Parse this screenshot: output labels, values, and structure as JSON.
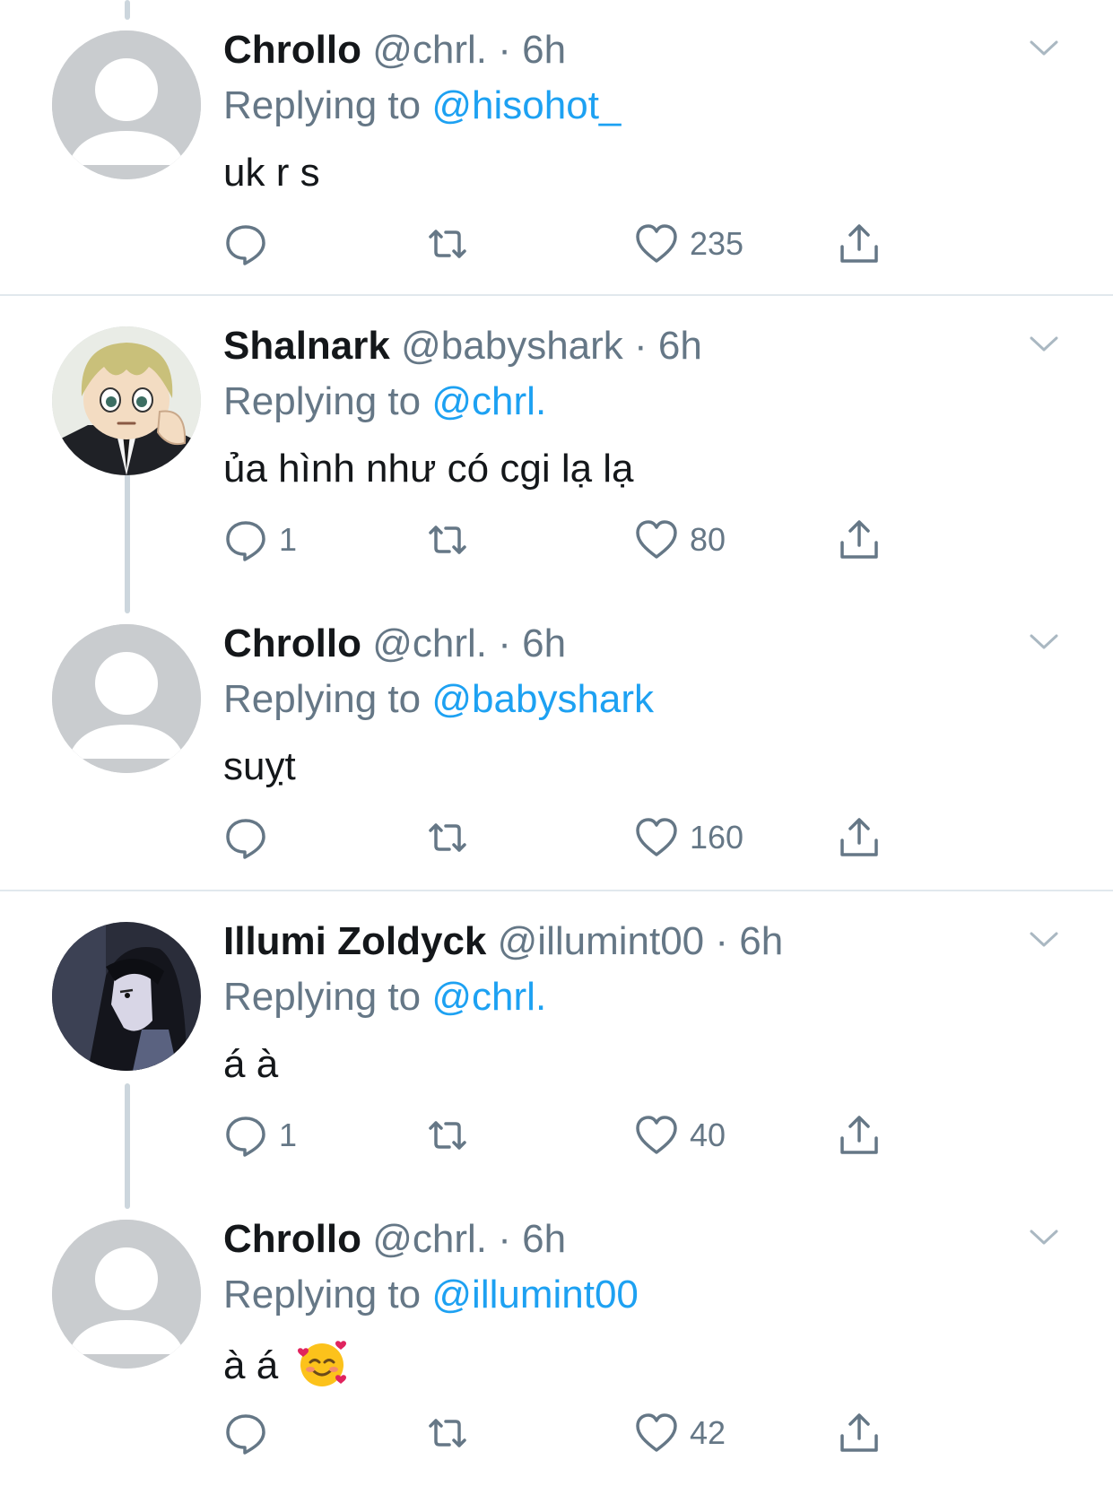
{
  "colors": {
    "text": "#14171a",
    "secondary": "#657786",
    "link": "#1da1f2",
    "thread_line": "#ccd6dd",
    "divider": "#e1e8ed",
    "default_avatar": "#c9cccf"
  },
  "icons": {
    "reply": "comment-bubble-icon",
    "retweet": "retweet-icon",
    "like": "heart-icon",
    "share": "share-icon",
    "more": "chevron-down-icon"
  },
  "tweets": [
    {
      "name": "Chrollo",
      "handle": "@chrl.",
      "dot": "·",
      "time": "6h",
      "replying_prefix": "Replying to",
      "replying_to": "@hisohot_",
      "text": "uk r s",
      "replies": "",
      "likes": "235",
      "avatar": "default-avatar"
    },
    {
      "name": "Shalnark",
      "handle": "@babyshark",
      "dot": "·",
      "time": "6h",
      "replying_prefix": "Replying to",
      "replying_to": "@chrl.",
      "text": "ủa hình như có cgi lạ lạ",
      "replies": "1",
      "likes": "80",
      "avatar": "anime-blond-avatar"
    },
    {
      "name": "Chrollo",
      "handle": "@chrl.",
      "dot": "·",
      "time": "6h",
      "replying_prefix": "Replying to",
      "replying_to": "@babyshark",
      "text": "suỵt",
      "replies": "",
      "likes": "160",
      "avatar": "default-avatar"
    },
    {
      "name": "Illumi Zoldyck",
      "handle": "@illumint00",
      "dot": "·",
      "time": "6h",
      "replying_prefix": "Replying to",
      "replying_to": "@chrl.",
      "text": "á à",
      "replies": "1",
      "likes": "40",
      "avatar": "anime-dark-hair-avatar"
    },
    {
      "name": "Chrollo",
      "handle": "@chrl.",
      "dot": "·",
      "time": "6h",
      "replying_prefix": "Replying to",
      "replying_to": "@illumint00",
      "text": "à á",
      "emoji": "smiling-face-with-hearts-emoji",
      "replies": "",
      "likes": "42",
      "avatar": "default-avatar"
    }
  ]
}
